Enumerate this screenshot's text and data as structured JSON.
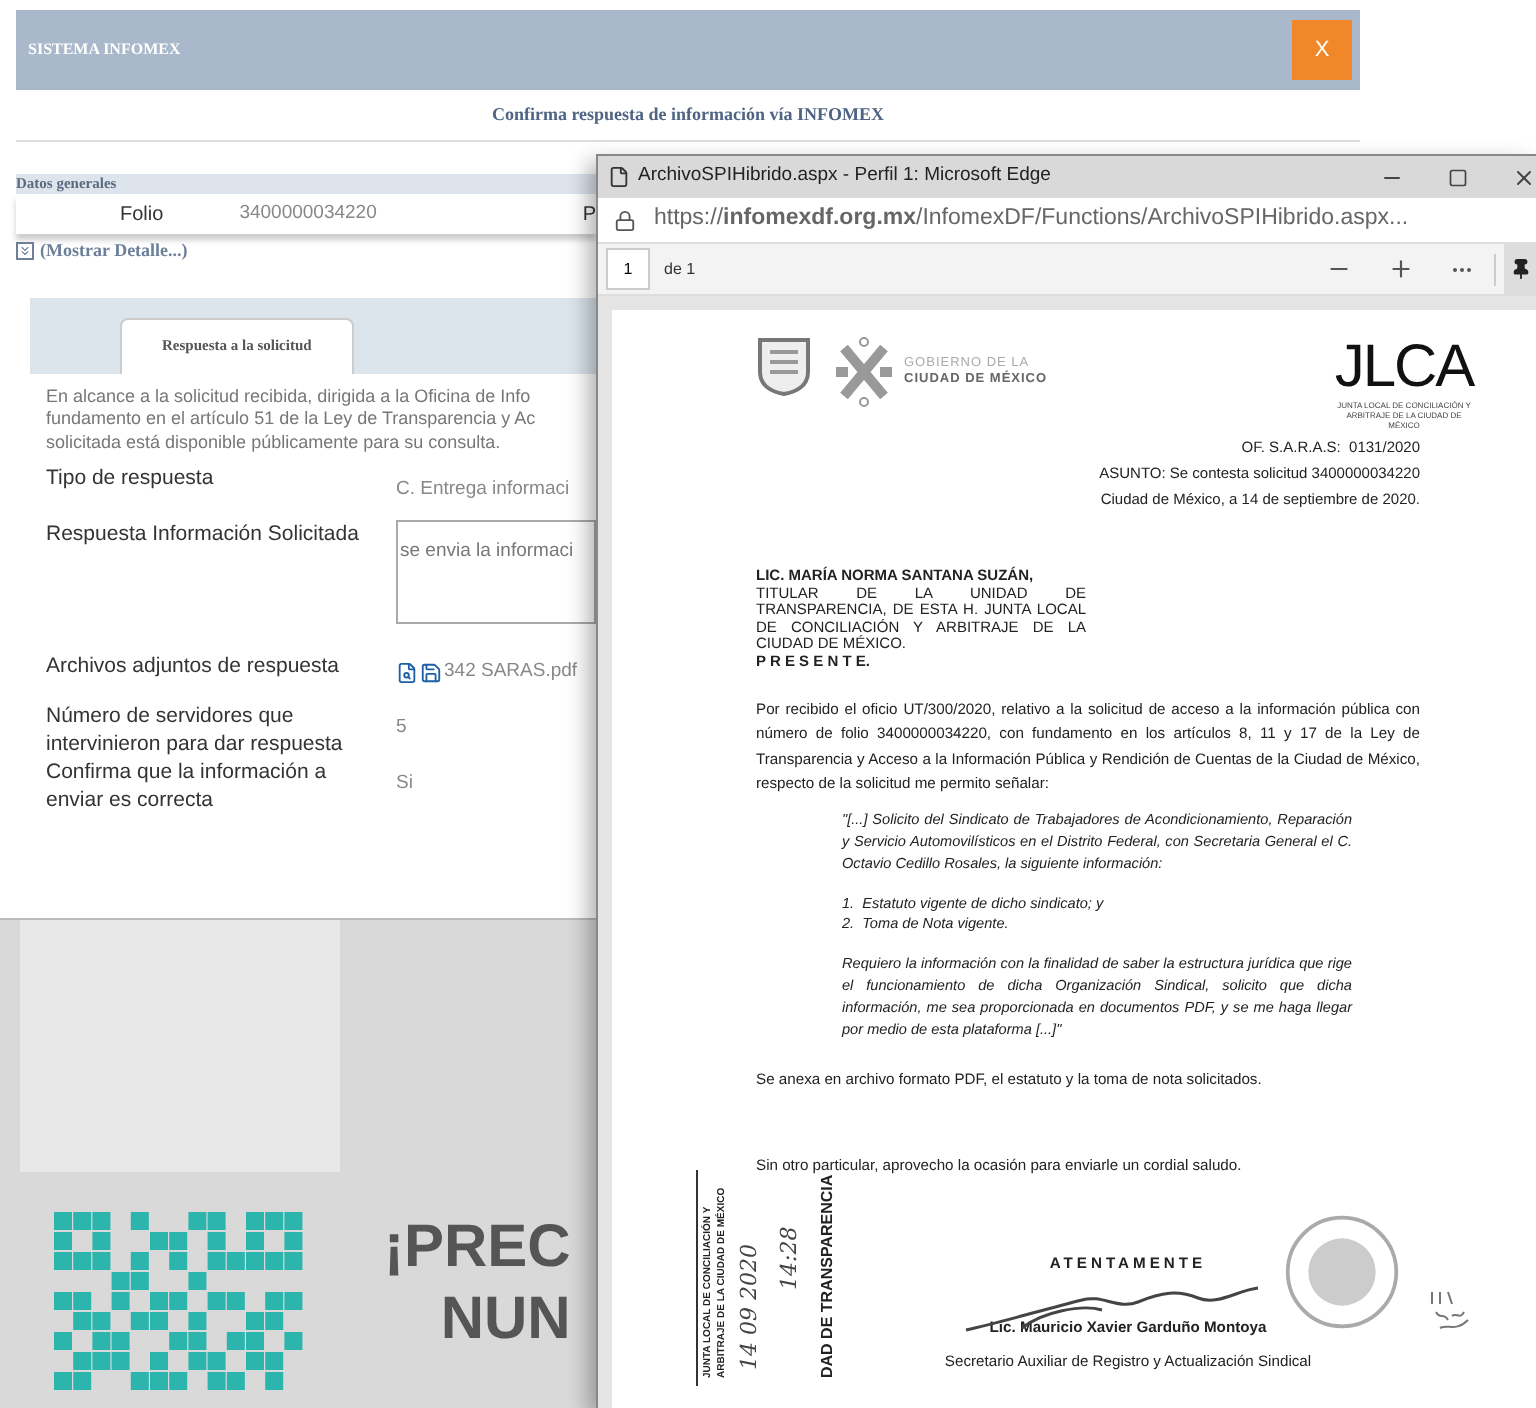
{
  "app": {
    "brand": "SISTEMA INFOMEX",
    "close_label": "X",
    "title": "Confirma respuesta de información vía INFOMEX",
    "section": "Datos generales",
    "folio_label": "Folio",
    "folio_value": "3400000034220",
    "cut_label": "P",
    "details_link": "(Mostrar Detalle...)",
    "tabs": [
      {
        "label": "Respuesta a la solicitud",
        "selected": true
      }
    ],
    "intro_lines": [
      "En alcance a la solicitud recibida, dirigida a la Oficina de Info",
      "fundamento en el artículo 51 de la Ley de Transparencia y Ac",
      "solicitada está disponible públicamente para su consulta."
    ],
    "fields": [
      {
        "kind": "text",
        "label": "Tipo de respuesta",
        "value": "C. Entrega informaci"
      },
      {
        "kind": "textarea",
        "label": "Respuesta Información Solicitada",
        "value": "se envia la informaci"
      },
      {
        "kind": "file",
        "label": "Archivos adjuntos de respuesta",
        "value": "342 SARAS.pdf"
      },
      {
        "kind": "text",
        "label": "Número de servidores que intervinieron para dar respuesta",
        "value": "5"
      },
      {
        "kind": "text",
        "label": "Confirma que la información a enviar es correcta",
        "value": "Si"
      }
    ]
  },
  "poster": {
    "lines": [
      "¡PREC",
      "NUN"
    ]
  },
  "browser": {
    "title": "ArchivoSPIHibrido.aspx - Perfil 1: Microsoft Edge",
    "url": "https://**infomexdf.org.mx**/InfomexDF/Functions/ArchivoSPIHibrido.aspx...",
    "page": "1",
    "page_of": "de 1"
  },
  "document": {
    "org_lines": [
      "GOBIERNO DE LA",
      "CIUDAD DE MÉXICO"
    ],
    "jlca": "JLCA",
    "jlca_caption": "JUNTA LOCAL DE CONCILIACIÓN Y ARBITRAJE DE LA CIUDAD DE MÉXICO",
    "reference_lines": [
      "OF. S.A.R.A.S:  0131/2020",
      "ASUNTO: Se contesta solicitud 3400000034220",
      "Ciudad de México, a 14 de septiembre de 2020."
    ],
    "addressee_name": "LIC. MARÍA NORMA SANTANA SUZÁN,",
    "addressee_title": "TITULAR DE LA UNIDAD DE TRANSPARENCIA, DE ESTA H. JUNTA LOCAL DE CONCILIACIÓN Y ARBITRAJE DE LA CIUDAD DE MÉXICO.",
    "presente": "P R E S E N T E.",
    "body": "Por recibido el oficio UT/300/2020, relativo a la solicitud de acceso a la información pública con número de folio 3400000034220, con fundamento en los artículos 8, 11 y 17 de la Ley de Transparencia y Acceso a la Información Pública y Rendición de Cuentas de la Ciudad de México, respecto de la solicitud me permito señalar:",
    "quote": "\"[...] Solicito del Sindicato de Trabajadores de Acondicionamiento, Reparación y Servicio Automovilísticos en el Distrito Federal, con Secretaria General el C. Octavio Cedillo Rosales, la siguiente información:",
    "list": [
      "1.  Estatuto vigente de dicho sindicato; y",
      "2.  Toma de Nota vigente."
    ],
    "quote_end": "Requiero la información con la finalidad de saber la estructura jurídica que rige el funcionamiento de dicha Organización Sindical, solicito que dicha información, me sea proporcionada en documentos PDF, y se me haga llegar por medio de esta plataforma [...]\"",
    "annex": "Se anexa en archivo formato PDF, el estatuto y la toma de nota solicitados.",
    "closing": "Sin otro particular, aprovecho la ocasión para enviarle un cordial saludo.",
    "sign_off": "ATENTAMENTE",
    "signer": "Lic. Mauricio Xavier Garduño Montoya",
    "signer_role": "Secretario Auxiliar de Registro y Actualización Sindical",
    "stamp": {
      "lines": [
        "JUNTA LOCAL DE CONCILIACIÓN Y",
        "ARBITRAJE DE LA CIUDAD DE MÉXICO"
      ],
      "date": "14 09 2020",
      "time": "14:28",
      "unit": "DAD DE TRANSPARENCIA"
    }
  }
}
